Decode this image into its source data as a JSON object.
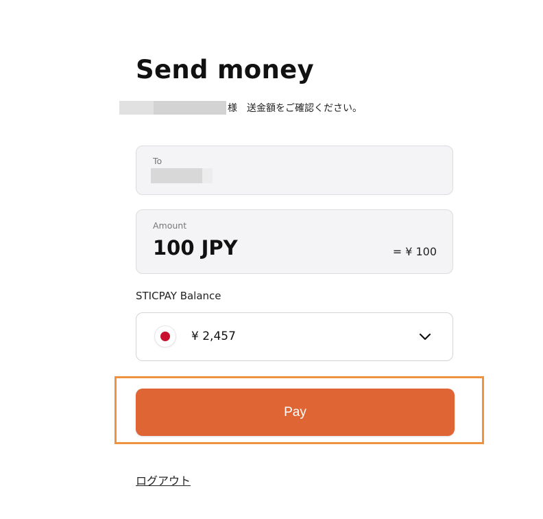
{
  "page": {
    "title": "Send money",
    "subtitle": "様　送金額をご確認ください。"
  },
  "to_field": {
    "label": "To"
  },
  "amount_field": {
    "label": "Amount",
    "value": "100 JPY",
    "converted": "= ¥ 100"
  },
  "balance": {
    "label": "STICPAY Balance",
    "currency_flag_icon": "japan-flag-icon",
    "value": "¥ 2,457",
    "dropdown_icon": "chevron-down-icon"
  },
  "actions": {
    "pay_label": "Pay",
    "logout_label": "ログアウト"
  },
  "colors": {
    "pay_button": "#e06535",
    "highlight_border": "#f0913d",
    "flag_red": "#c8102e"
  }
}
